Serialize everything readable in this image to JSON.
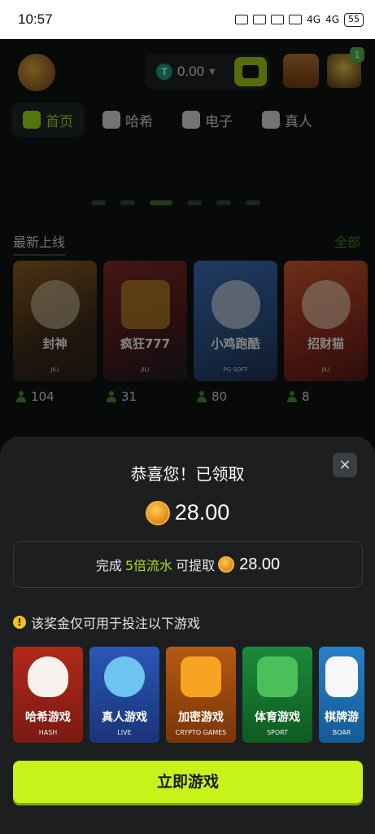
{
  "status_bar": {
    "time": "10:57",
    "network_1": "4G",
    "network_2": "4G",
    "battery": "55"
  },
  "header": {
    "balance": "0.00",
    "currency_icon": "T",
    "notification_count": "1"
  },
  "tabs": [
    {
      "label": "首页",
      "icon": "home-icon",
      "active": true
    },
    {
      "label": "哈希",
      "icon": "bitcoin-icon",
      "active": false
    },
    {
      "label": "电子",
      "icon": "slot-777-icon",
      "active": false
    },
    {
      "label": "真人",
      "icon": "cards-icon",
      "active": false
    }
  ],
  "new_section": {
    "title": "最新上线",
    "all_link": "全部",
    "games": [
      {
        "name": "封神",
        "provider": "JILI",
        "players": "104"
      },
      {
        "name": "疯狂777",
        "provider": "JILI",
        "players": "31"
      },
      {
        "name": "小鸡跑酷",
        "provider": "PG SOFT",
        "players": "80"
      },
      {
        "name": "招财猫",
        "provider": "JILI",
        "players": "8"
      }
    ]
  },
  "sheet": {
    "title": "恭喜您！已领取",
    "amount": "28.00",
    "wager_prefix": "完成",
    "wager_highlight": "5倍流水",
    "wager_suffix": "可提取",
    "wager_amount": "28.00",
    "notice": "该奖金仅可用于投注以下游戏",
    "close_symbol": "×",
    "categories": [
      {
        "name": "哈希游戏",
        "en": "HASH"
      },
      {
        "name": "真人游戏",
        "en": "LIVE"
      },
      {
        "name": "加密游戏",
        "en": "CRYPTO GAMES"
      },
      {
        "name": "体育游戏",
        "en": "SPORT"
      },
      {
        "name": "棋牌游",
        "en": "BOAR"
      }
    ],
    "play_button": "立即游戏"
  },
  "colors": {
    "accent": "#c7f21a",
    "highlight": "#a7dc1c",
    "sheet_bg": "#1c1e20"
  }
}
